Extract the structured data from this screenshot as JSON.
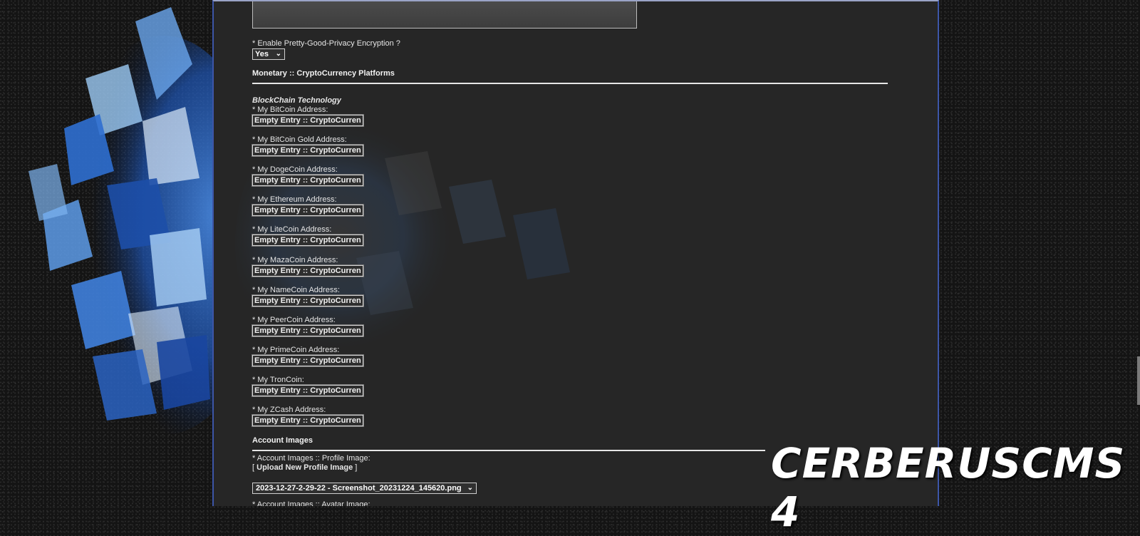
{
  "pgp": {
    "label": "* Enable Pretty-Good-Privacy Encryption ?",
    "selected": "Yes"
  },
  "monetary": {
    "title": "Monetary :: CryptoCurrency Platforms",
    "subtitle": "BlockChain Technology",
    "entries": [
      {
        "label": "* My BitCoin Address:",
        "value": "Empty Entry :: CryptoCurren"
      },
      {
        "label": "* My BitCoin Gold Address:",
        "value": "Empty Entry :: CryptoCurren"
      },
      {
        "label": "* My DogeCoin Address:",
        "value": "Empty Entry :: CryptoCurren"
      },
      {
        "label": "* My Ethereum Address:",
        "value": "Empty Entry :: CryptoCurren"
      },
      {
        "label": "* My LiteCoin Address:",
        "value": "Empty Entry :: CryptoCurren"
      },
      {
        "label": "* My MazaCoin Address:",
        "value": "Empty Entry :: CryptoCurren"
      },
      {
        "label": "* My NameCoin Address:",
        "value": "Empty Entry :: CryptoCurren"
      },
      {
        "label": "* My PeerCoin Address:",
        "value": "Empty Entry :: CryptoCurren"
      },
      {
        "label": "* My PrimeCoin Address:",
        "value": "Empty Entry :: CryptoCurren"
      },
      {
        "label": "* My TronCoin:",
        "value": "Empty Entry :: CryptoCurren"
      },
      {
        "label": "* My ZCash Address:",
        "value": "Empty Entry :: CryptoCurren"
      }
    ]
  },
  "account_images": {
    "title": "Account Images",
    "profile_label": "* Account Images :: Profile Image:",
    "upload_open": "[ ",
    "upload_link": "Upload New Profile Image",
    "upload_close": " ]",
    "profile_selected": "2023-12-27-2-29-22 - Screenshot_20231224_145620.png",
    "avatar_label": "* Account Images :: Avatar Image:"
  },
  "brand": "CERBERUSCMS 4"
}
